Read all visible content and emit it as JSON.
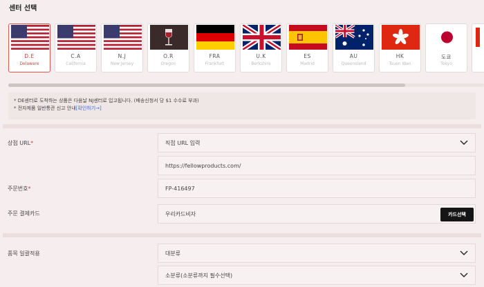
{
  "section_title": "센터 선택",
  "centers": [
    {
      "code": "D.E",
      "city": "Delaware",
      "flag": "us-flag",
      "selected": true
    },
    {
      "code": "C.A",
      "city": "California",
      "flag": "us-flag",
      "selected": false
    },
    {
      "code": "N.J",
      "city": "New Jersey",
      "flag": "us-flag",
      "selected": false
    },
    {
      "code": "O.R",
      "city": "Oregon",
      "flag": "oregon-wine-icon",
      "selected": false
    },
    {
      "code": "FRA",
      "city": "Frankfurt",
      "flag": "germany-flag",
      "selected": false
    },
    {
      "code": "U.K",
      "city": "Berkshire",
      "flag": "uk-flag",
      "selected": false
    },
    {
      "code": "ES",
      "city": "Madrid",
      "flag": "spain-flag",
      "selected": false
    },
    {
      "code": "AU",
      "city": "Queensland",
      "flag": "australia-flag",
      "selected": false
    },
    {
      "code": "HK",
      "city": "Tsuen Wan",
      "flag": "hongkong-flag",
      "selected": false
    },
    {
      "code": "도쿄",
      "city": "Tokyo",
      "flag": "japan-flag",
      "selected": false
    }
  ],
  "notice": {
    "line1": "* DE센터로 도착하는 상품은 다음날 NJ센터로 입고됩니다. (배송신청서 당 $1 수수료 부과)",
    "line2_prefix": "* 전자제품 일반통관 신고 안내",
    "line2_link": "[확인하기→]"
  },
  "form": {
    "product_url": {
      "label": "상점 URL",
      "select_value": "직접 URL 입력",
      "url_value": "https://fellowproducts.com/"
    },
    "order_number": {
      "label": "주문번호",
      "value": "FP-416497"
    },
    "payment_card": {
      "label": "주문 결제카드",
      "value": "우리카드비자",
      "button_label": "카드선택"
    },
    "category": {
      "label": "품목 일괄적용",
      "major_value": "대분류",
      "minor_value": "소분류(소분류까지 필수선택)"
    }
  },
  "colors": {
    "accent": "#d23c36",
    "link": "#3b6fd6",
    "button_bg": "#151515"
  }
}
